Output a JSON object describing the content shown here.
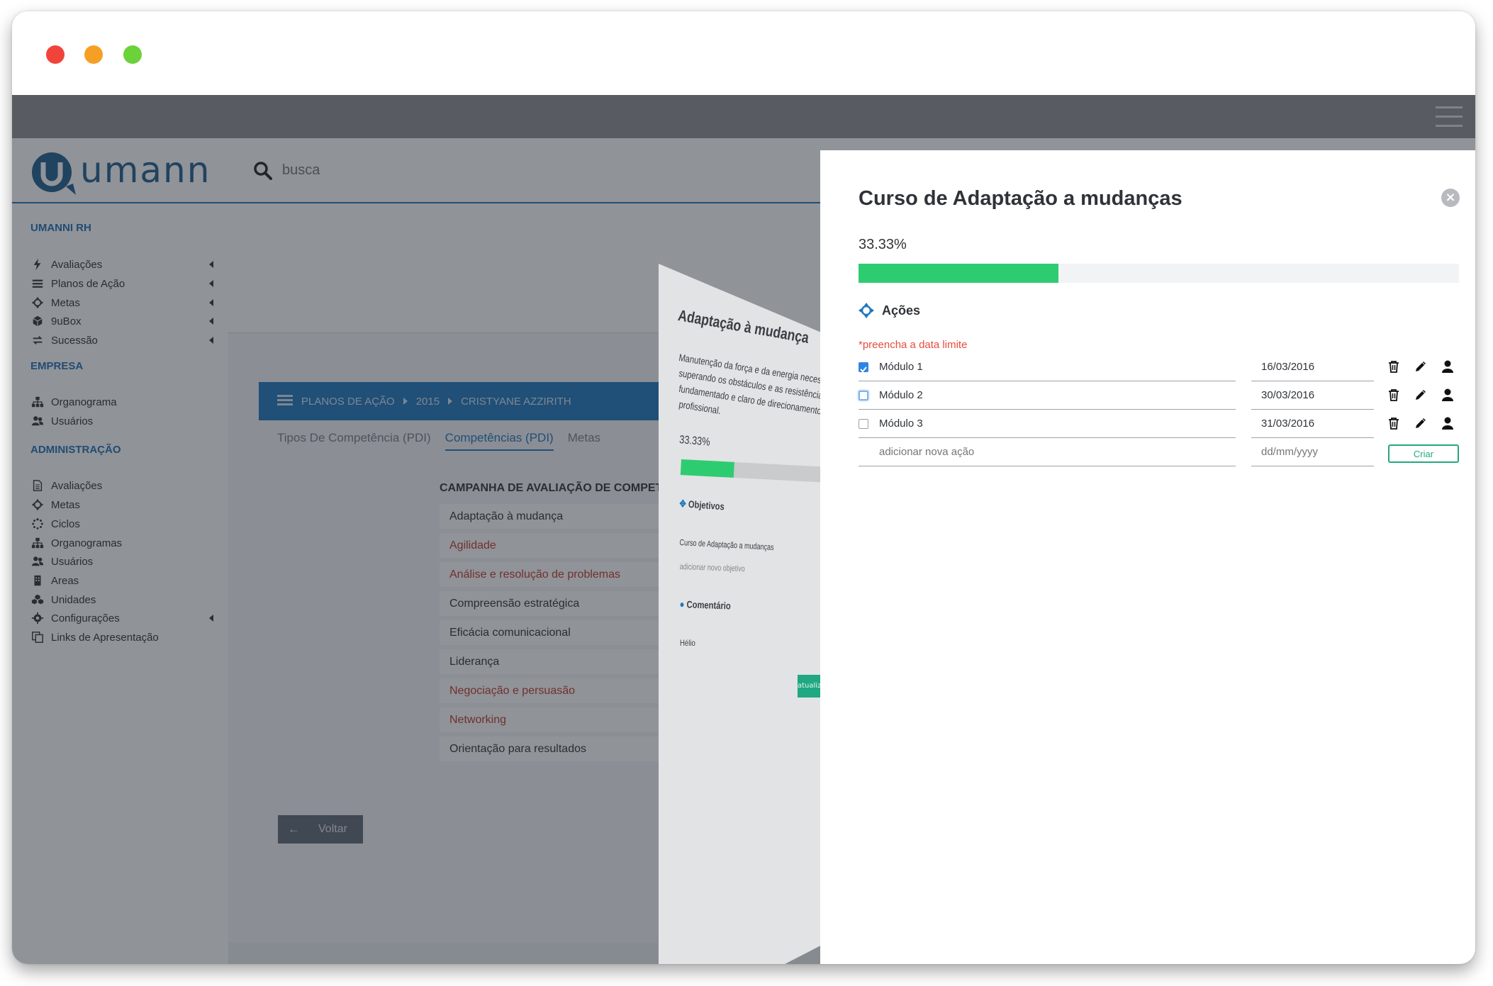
{
  "window": {
    "traffic_lights": {
      "close": "#f0443a",
      "minimize": "#f5a024",
      "maximize": "#6bd23a"
    }
  },
  "brand": {
    "logo_text": "umanni",
    "logo_color": "#1e5f8e"
  },
  "search": {
    "placeholder": "busca"
  },
  "sidebar": {
    "sections": [
      {
        "title": "UMANNI RH",
        "items": [
          {
            "label": "Avaliações",
            "icon": "bolt-icon",
            "has_submenu": true
          },
          {
            "label": "Planos de Ação",
            "icon": "list-icon",
            "has_submenu": true
          },
          {
            "label": "Metas",
            "icon": "crosshair-icon",
            "has_submenu": true
          },
          {
            "label": "9uBox",
            "icon": "cube-icon",
            "has_submenu": true
          },
          {
            "label": "Sucessão",
            "icon": "exchange-icon",
            "has_submenu": true
          }
        ]
      },
      {
        "title": "EMPRESA",
        "items": [
          {
            "label": "Organograma",
            "icon": "sitemap-icon",
            "has_submenu": false
          },
          {
            "label": "Usuários",
            "icon": "users-icon",
            "has_submenu": false
          }
        ]
      },
      {
        "title": "ADMINISTRAÇÃO",
        "items": [
          {
            "label": "Avaliações",
            "icon": "file-icon",
            "has_submenu": false
          },
          {
            "label": "Metas",
            "icon": "crosshair-icon",
            "has_submenu": false
          },
          {
            "label": "Ciclos",
            "icon": "spinner-icon",
            "has_submenu": false
          },
          {
            "label": "Organogramas",
            "icon": "sitemap-icon",
            "has_submenu": false
          },
          {
            "label": "Usuários",
            "icon": "users-icon",
            "has_submenu": false
          },
          {
            "label": "Areas",
            "icon": "building-icon",
            "has_submenu": false
          },
          {
            "label": "Unidades",
            "icon": "cubes-icon",
            "has_submenu": false
          },
          {
            "label": "Configurações",
            "icon": "gear-icon",
            "has_submenu": true
          },
          {
            "label": "Links de Apresentação",
            "icon": "copy-icon",
            "has_submenu": false
          }
        ]
      }
    ]
  },
  "breadcrumb": {
    "items": [
      "PLANOS DE AÇÃO",
      "2015",
      "CRISTYANE AZZIRITH"
    ]
  },
  "tabs": [
    {
      "label": "Tipos De Competência (PDI)",
      "active": false
    },
    {
      "label": "Competências (PDI)",
      "active": true
    },
    {
      "label": "Metas",
      "active": false
    }
  ],
  "campaign": {
    "title": "CAMPANHA DE AVALIAÇÃO DE COMPETÊNCIAS"
  },
  "competencies": [
    {
      "label": "Adaptação à mudança",
      "highlight": false
    },
    {
      "label": "Agilidade",
      "highlight": true
    },
    {
      "label": "Análise e resolução de problemas",
      "highlight": true
    },
    {
      "label": "Compreensão estratégica",
      "highlight": false
    },
    {
      "label": "Eficácia comunicacional",
      "highlight": false
    },
    {
      "label": "Liderança",
      "highlight": false
    },
    {
      "label": "Negociação e persuasão",
      "highlight": true
    },
    {
      "label": "Networking",
      "highlight": true
    },
    {
      "label": "Orientação para resultados",
      "highlight": false
    }
  ],
  "back_button": {
    "label": "Voltar"
  },
  "ghost_card": {
    "title": "Adaptação à mudança",
    "description": [
      "Manutenção da força e da energia necessárias",
      "superando os obstáculos e as resistências, pe",
      "fundamentado e claro de direcionamento, o",
      "profissional."
    ],
    "progress": "33.33%",
    "objectives_label": "Objetivos",
    "objective_item": "Curso de Adaptação a mudanças",
    "objective_placeholder": "adicionar novo objetivo",
    "comment_label": "Comentário",
    "comment_text": "Hélio",
    "button_label": "atualiza"
  },
  "panel": {
    "title": "Curso de Adaptação a mudanças",
    "progress_label": "33.33%",
    "progress_fraction": 0.3333,
    "actions_label": "Ações",
    "warning": "*preencha a data limite",
    "actions": [
      {
        "name": "Módulo 1",
        "date": "16/03/2016",
        "checked": true,
        "focused": false
      },
      {
        "name": "Módulo 2",
        "date": "30/03/2016",
        "checked": false,
        "focused": true
      },
      {
        "name": "Módulo 3",
        "date": "31/03/2016",
        "checked": false,
        "focused": false
      }
    ],
    "new_action": {
      "placeholder": "adicionar nova ação",
      "date_placeholder": "dd/mm/yyyy",
      "create_label": "Criar"
    },
    "row_icons": [
      "trash-icon",
      "pencil-icon",
      "user-icon"
    ]
  }
}
